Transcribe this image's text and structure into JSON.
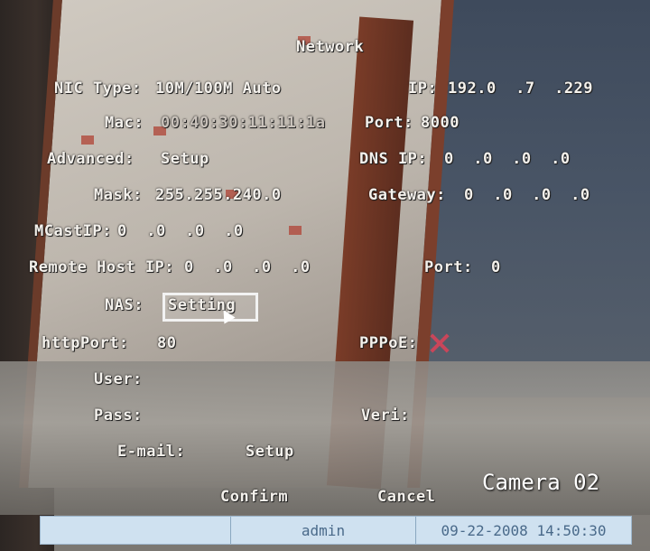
{
  "title": "Network",
  "nic": {
    "label": "NIC Type:",
    "value": "10M/100M Auto"
  },
  "ip": {
    "label": "IP:",
    "value": "192.0  .7  .229"
  },
  "mac": {
    "label": "Mac:",
    "value": "00:40:30:11:11:1a"
  },
  "port": {
    "label": "Port:",
    "value": "8000"
  },
  "advanced": {
    "label": "Advanced:",
    "value": "Setup"
  },
  "dns": {
    "label": "DNS IP:",
    "value": "0  .0  .0  .0"
  },
  "mask": {
    "label": "Mask:",
    "value": "255.255.240.0"
  },
  "gateway": {
    "label": "Gateway:",
    "value": "0  .0  .0  .0"
  },
  "mcast": {
    "label": "MCastIP:",
    "value": "0  .0  .0  .0"
  },
  "remote_host": {
    "label": "Remote Host IP:",
    "value": "0  .0  .0  .0"
  },
  "remote_port": {
    "label": "Port:",
    "value": "0"
  },
  "nas": {
    "label": "NAS:",
    "value": "Setting"
  },
  "http_port": {
    "label": "httpPort:",
    "value": "80"
  },
  "pppoe": {
    "label": "PPPoE:",
    "icon": "x-icon",
    "color": "#c9465a"
  },
  "user": {
    "label": "User:"
  },
  "pass": {
    "label": "Pass:"
  },
  "verify": {
    "label": "Veri:"
  },
  "email": {
    "label": "E-mail:",
    "value": "Setup"
  },
  "confirm_label": "Confirm",
  "cancel_label": "Cancel",
  "camera_label": "Camera 02",
  "statusbar": {
    "user": "admin",
    "datetime": "09-22-2008 14:50:30"
  }
}
